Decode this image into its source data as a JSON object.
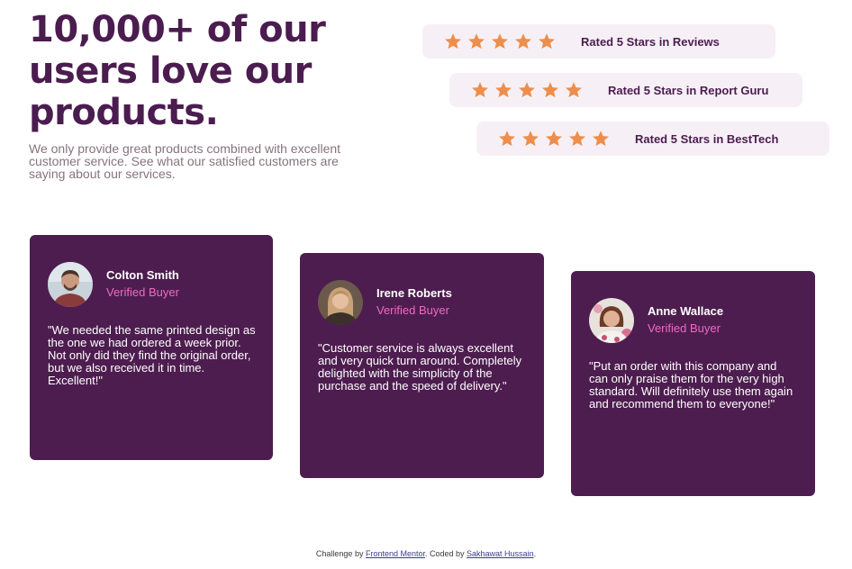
{
  "header": {
    "title": "10,000+ of our users love our products.",
    "subtitle": "We only provide great products combined with excellent customer service. See what our satisfied customers are saying about our services."
  },
  "ratings": [
    {
      "stars": 5,
      "label": "Rated 5 Stars in Reviews"
    },
    {
      "stars": 5,
      "label": "Rated 5 Stars in Report Guru"
    },
    {
      "stars": 5,
      "label": "Rated 5 Stars in BestTech"
    }
  ],
  "testimonials": [
    {
      "name": "Colton Smith",
      "badge": "Verified Buyer",
      "quote": "\"We needed the same printed design as the one we had ordered a week prior. Not only did they find the original order, but we also received it in time. Excellent!\""
    },
    {
      "name": "Irene Roberts",
      "badge": "Verified Buyer",
      "quote": "\"Customer service is always excellent and very quick turn around. Completely delighted with the simplicity of the purchase and the speed of delivery.\""
    },
    {
      "name": "Anne Wallace",
      "badge": "Verified Buyer",
      "quote": "\"Put an order with this company and can only praise them for the very high standard. Will definitely use them again and recommend them to everyone!\""
    }
  ],
  "footer": {
    "prefix": "Challenge by ",
    "challenge_link": "Frontend Mentor",
    "middle": ". Coded by ",
    "author_link": "Sakhawat Hussain",
    "suffix": "."
  },
  "colors": {
    "primary": "#4b1c4f",
    "card_bg": "#4d1d4f",
    "accent_pink": "#ee6bc1",
    "star": "#ee8e4c",
    "rating_bg": "#f6f0f6"
  }
}
